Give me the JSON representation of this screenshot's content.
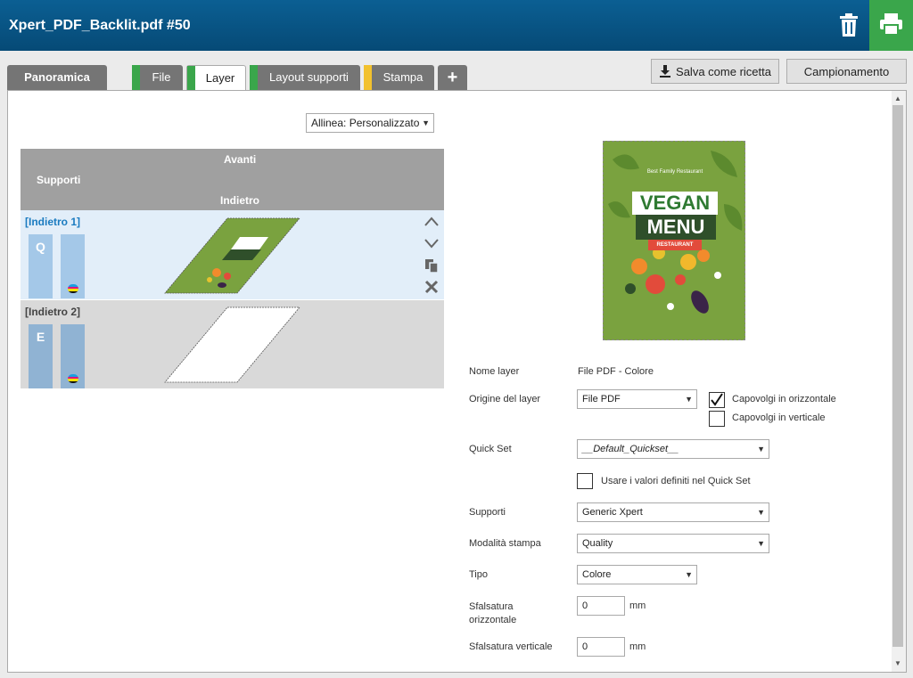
{
  "header": {
    "title": "Xpert_PDF_Backlit.pdf #50"
  },
  "tabs": [
    {
      "label": "Panoramica",
      "stripe": ""
    },
    {
      "label": "File",
      "stripe": "#3aa64b"
    },
    {
      "label": "Layer",
      "stripe": "#3aa64b"
    },
    {
      "label": "Layout supporti",
      "stripe": "#3aa64b"
    },
    {
      "label": "Stampa",
      "stripe": "#f2c12e"
    }
  ],
  "add_tab_label": "+",
  "buttons": {
    "save_recipe": "Salva come ricetta",
    "sampling": "Campionamento"
  },
  "align": {
    "value": "Allinea: Personalizzato"
  },
  "layers_table": {
    "col_media": "Supporti",
    "front": "Avanti",
    "back": "Indietro",
    "rows": [
      {
        "label": "[Indietro 1]",
        "chip": "Q"
      },
      {
        "label": "[Indietro 2]",
        "chip": "E"
      }
    ]
  },
  "preview": {
    "small_text": "Best Family Restaurant",
    "line1": "VEGAN",
    "line2": "MENU",
    "ribbon": "RESTAURANT"
  },
  "form": {
    "layer_name_label": "Nome layer",
    "layer_name_value": "File PDF - Colore",
    "origin_label": "Origine del layer",
    "origin_value": "File PDF",
    "flip_h_label": "Capovolgi in orizzontale",
    "flip_h_checked": true,
    "flip_v_label": "Capovolgi in verticale",
    "flip_v_checked": false,
    "quickset_label": "Quick Set",
    "quickset_value": "__Default_Quickset__",
    "use_quickset_label": "Usare i valori definiti nel Quick Set",
    "media_label": "Supporti",
    "media_value": "Generic Xpert",
    "mode_label": "Modalità stampa",
    "mode_value": "Quality",
    "type_label": "Tipo",
    "type_value": "Colore",
    "offset_h_label": "Sfalsatura orizzontale",
    "offset_h_value": "0",
    "offset_v_label": "Sfalsatura verticale",
    "offset_v_value": "0",
    "unit": "mm"
  }
}
